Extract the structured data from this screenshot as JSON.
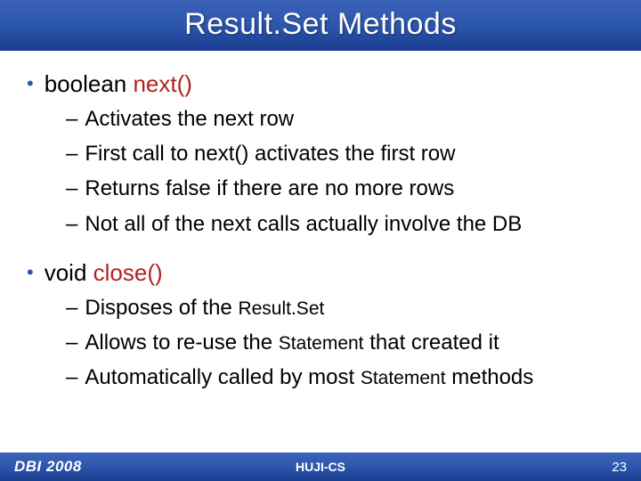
{
  "title": "Result.Set Methods",
  "bullets": [
    {
      "prefix": "boolean ",
      "method": "next()",
      "sub": [
        "Activates the next row",
        "First call to next() activates the first row",
        "Returns false if there are no more rows",
        "Not all of the next calls actually involve the DB"
      ]
    },
    {
      "prefix": "void ",
      "method": "close()",
      "sub_rich": [
        {
          "pre": "Disposes of the ",
          "code": "Result.Set",
          "post": ""
        },
        {
          "pre": "Allows to re-use the ",
          "code": "Statement",
          "post": " that created it"
        },
        {
          "pre": "Automatically called by most ",
          "code": "Statement",
          "post": " methods"
        }
      ]
    }
  ],
  "footer": {
    "left": "DBI 2008",
    "center": "HUJI-CS",
    "right": "23"
  }
}
